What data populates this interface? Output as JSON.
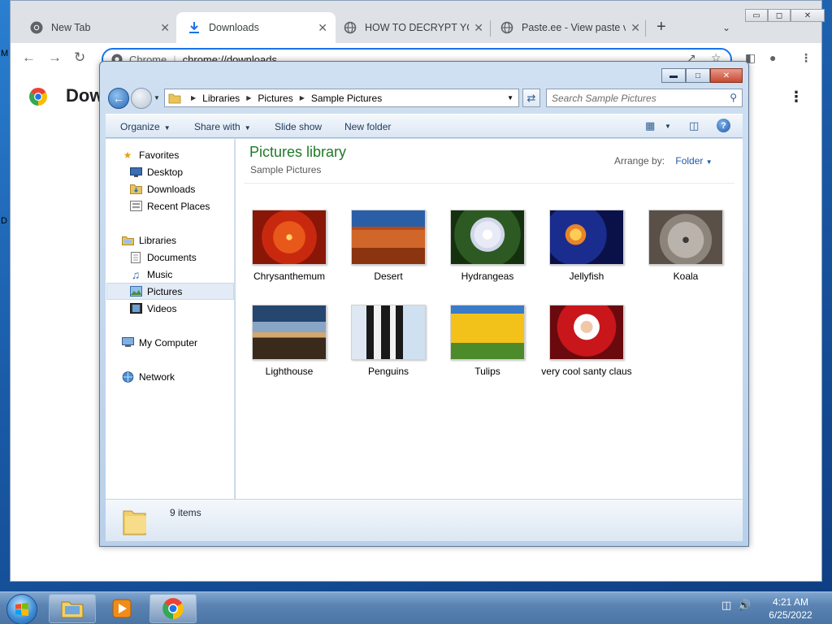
{
  "desktop": {
    "left_fragment_1": "M",
    "left_fragment_2": "D"
  },
  "chrome": {
    "tabs": [
      {
        "title": "New Tab",
        "icon": "chrome-icon"
      },
      {
        "title": "Downloads",
        "icon": "download-icon",
        "active": true
      },
      {
        "title": "HOW TO DECRYPT YOU",
        "icon": "globe-icon"
      },
      {
        "title": "Paste.ee - View paste vp",
        "icon": "globe-icon"
      }
    ],
    "tab_close": "✕",
    "new_tab": "+",
    "omnibox_label": "Chrome",
    "omnibox_url": "chrome://downloads",
    "page_title": "Dow",
    "window_controls": {
      "minimize": "▭",
      "restore": "◻",
      "close": "✕"
    }
  },
  "explorer": {
    "breadcrumb": [
      "Libraries",
      "Pictures",
      "Sample Pictures"
    ],
    "search_placeholder": "Search Sample Pictures",
    "commands": [
      "Organize",
      "Share with",
      "Slide show",
      "New folder"
    ],
    "nav": {
      "favorites": "Favorites",
      "desktop": "Desktop",
      "downloads": "Downloads",
      "recent": "Recent Places",
      "libraries": "Libraries",
      "documents": "Documents",
      "music": "Music",
      "pictures": "Pictures",
      "videos": "Videos",
      "computer": "My Computer",
      "network": "Network"
    },
    "library_title": "Pictures library",
    "library_subtitle": "Sample Pictures",
    "arrange_label": "Arrange by:",
    "arrange_value": "Folder",
    "items": [
      "Chrysanthemum",
      "Desert",
      "Hydrangeas",
      "Jellyfish",
      "Koala",
      "Lighthouse",
      "Penguins",
      "Tulips",
      "very cool santy claus"
    ],
    "status_count": "9 items"
  },
  "taskbar": {
    "time": "4:21 AM",
    "date": "6/25/2022"
  },
  "colors": {
    "library_title": "#1e7a27",
    "accent_link": "#1e5aa8",
    "omnibox_focus": "#1a73e8"
  }
}
